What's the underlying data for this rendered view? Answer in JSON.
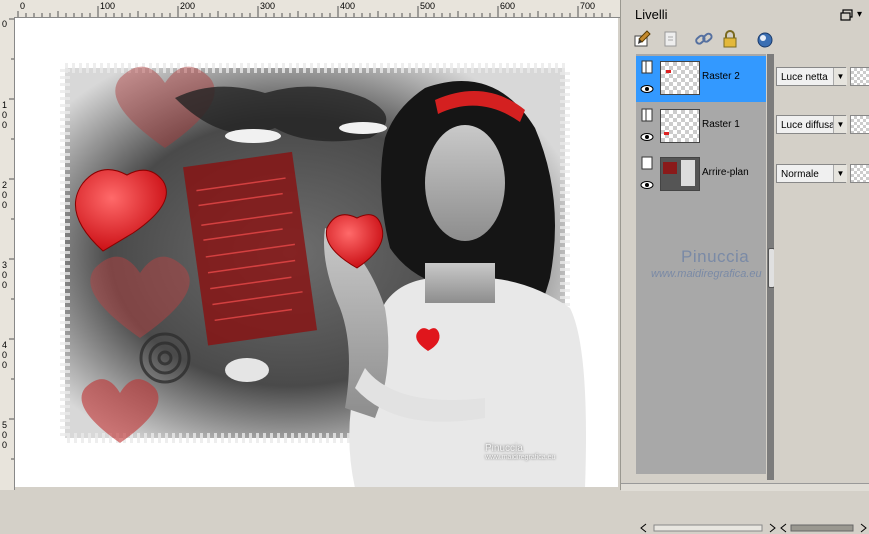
{
  "ruler": {
    "top_labels": [
      "0",
      "100",
      "200",
      "300",
      "400",
      "500",
      "600",
      "700"
    ],
    "left_labels": [
      "0",
      "1",
      "0",
      "0",
      "2",
      "0",
      "0",
      "3",
      "0",
      "0",
      "4",
      "0",
      "0",
      "5",
      "0",
      "0"
    ]
  },
  "canvas": {
    "watermark_name": "Pinuccia",
    "watermark_url": "www.maidiregrafica.eu"
  },
  "panel": {
    "title": "Livelli",
    "dropdown_glyph": "▾",
    "layers": [
      {
        "name": "Raster 2",
        "selected": true,
        "blend": "Luce netta"
      },
      {
        "name": "Raster 1",
        "selected": false,
        "blend": "Luce diffusa"
      },
      {
        "name": "Arrire-plan",
        "selected": false,
        "blend": "Normale"
      }
    ],
    "watermark_name": "Pinuccia",
    "watermark_url": "www.maidiregrafica.eu"
  },
  "icons": [
    "paintbrush-icon",
    "new-layer-icon",
    "link-icon",
    "lock-icon",
    "mask-icon",
    "eye-icon",
    "restore-window-icon",
    "scroll-left-icon",
    "scroll-right-icon"
  ],
  "colors": {
    "accent": "#3399ff",
    "layer_list_bg": "#a8a8a8",
    "panel_bg": "#d4d0c8",
    "heart_red": "#e0161c"
  }
}
